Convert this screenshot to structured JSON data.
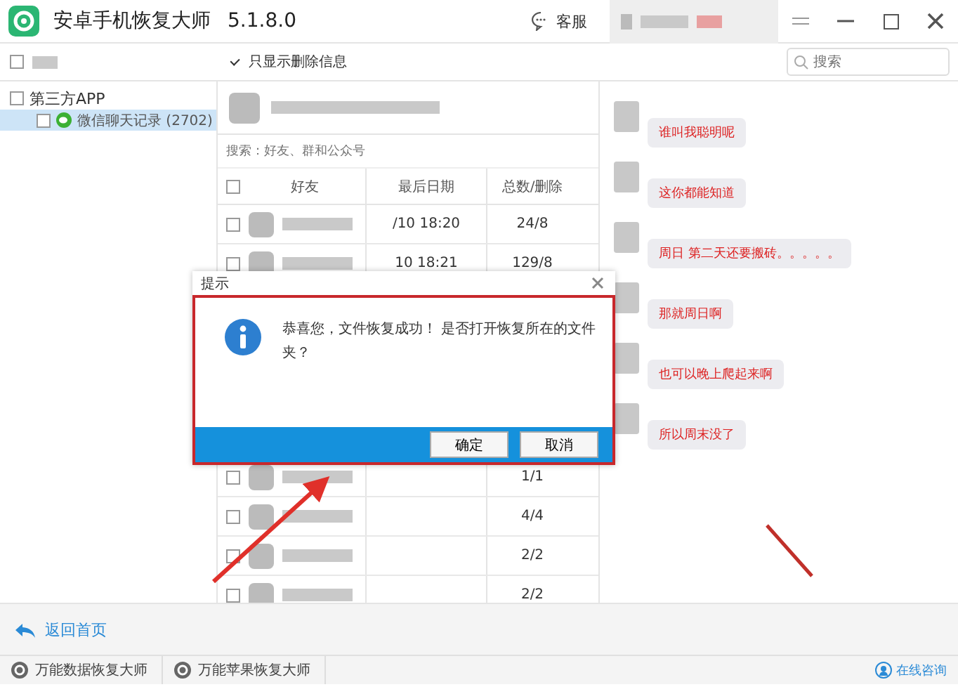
{
  "window": {
    "title": "安卓手机恢复大师",
    "version": "5.1.8.0",
    "service_label": "客服"
  },
  "toolbar": {
    "select_all": {
      "checked": false
    },
    "filter": {
      "label": "只显示删除信息",
      "checked": true
    },
    "search": {
      "placeholder": "搜索"
    }
  },
  "tree": [
    {
      "label": "第三方APP",
      "checked": false,
      "children": [
        {
          "label": "微信聊天记录 (2702)",
          "checked": false,
          "selected": true
        }
      ]
    }
  ],
  "contacts": {
    "select_all_checked": false,
    "search_placeholder": "搜索：好友、群和公众号",
    "columns": [
      "好友",
      "最后日期",
      "总数/删除"
    ],
    "rows": [
      {
        "date": "/10 18:20",
        "count": "24/8",
        "checked": false
      },
      {
        "date": "10 18:21",
        "count": "129/8",
        "checked": false
      },
      {
        "count": "1/1",
        "checked": false
      },
      {
        "count": "4/4",
        "checked": false
      },
      {
        "count": "2/2",
        "checked": false
      },
      {
        "count": "2/2",
        "checked": false
      }
    ]
  },
  "messages": [
    {
      "text": "谁叫我聪明呢"
    },
    {
      "text": "这你都能知道"
    },
    {
      "text": "周日 第二天还要搬砖。。。。。"
    },
    {
      "text": "那就周日啊"
    },
    {
      "text": "也可以晚上爬起来啊"
    },
    {
      "text": "所以周末没了"
    }
  ],
  "dialog": {
    "title": "提示",
    "message": "恭喜您，文件恢复成功！ 是否打开恢复所在的文件夹？",
    "buttons": [
      "确定",
      "取消"
    ]
  },
  "back_link": "返回首页",
  "footer": {
    "tabs": [
      "万能数据恢复大师",
      "万能苹果恢复大师"
    ],
    "consult": "在线咨询"
  }
}
